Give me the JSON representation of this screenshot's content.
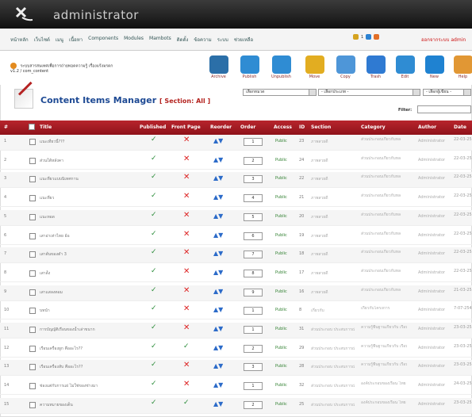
{
  "app": {
    "title": "administrator"
  },
  "menu": {
    "items": [
      "หน้าหลัก",
      "เว็บไซต์",
      "เมนู",
      "เนื้อหา",
      "Components",
      "Modules",
      "Mambots",
      "ติดตั้ง",
      "ข้อความ",
      "ระบบ",
      "ช่วยเหลือ"
    ],
    "count": "1",
    "logout": "ออกจากระบบ admin"
  },
  "breadcrumb": {
    "line1": "ระบบสารสนเทศเพื่อการถ่ายทอดความรู้ เรื่องแร้งมรดก",
    "line2": "v1.2 / com_content"
  },
  "toolbar": [
    {
      "label": "Archive",
      "color": "#2b6fa8"
    },
    {
      "label": "Publish",
      "color": "#2f8cd3"
    },
    {
      "label": "Unpublish",
      "color": "#2f8cd3"
    },
    {
      "label": "Move",
      "color": "#e2ad21"
    },
    {
      "label": "Copy",
      "color": "#4e96d8"
    },
    {
      "label": "Trash",
      "color": "#2f7ad2"
    },
    {
      "label": "Edit",
      "color": "#2f8cd3"
    },
    {
      "label": "New",
      "color": "#1f82d1"
    },
    {
      "label": "Help",
      "color": "#e19734"
    }
  ],
  "manager": {
    "title": "Content Items Manager",
    "section": "[ Section: All ]"
  },
  "filters": {
    "category": "เลือกหมวด",
    "type": "- เลือกประเภท -",
    "author": "- เลือกผู้เขียน -",
    "filter_label": "Filter:"
  },
  "columns": {
    "num": "#",
    "check": "",
    "title": "Title",
    "published": "Published",
    "front": "Front Page",
    "reorder": "Reorder",
    "order": "Order",
    "access": "Access",
    "id": "ID",
    "section": "Section",
    "category": "Category",
    "author": "Author",
    "date": "Date"
  },
  "rows": [
    {
      "num": "1",
      "title": "แนะเที่ยวนี้???",
      "published": "✓",
      "front": "✕",
      "order": "1",
      "access": "Public",
      "id": "23",
      "section": "ภาพสวยดี",
      "category": "ส่วนประกอบเกี่ยวกับหล",
      "author": "Administrator",
      "date": "22-03-2551"
    },
    {
      "num": "2",
      "title": "ส่วนใต้หลังคา",
      "published": "✓",
      "front": "✕",
      "order": "2",
      "access": "Public",
      "id": "24",
      "section": "ภาพสวยดี",
      "category": "ส่วนประกอบเกี่ยวกับหล",
      "author": "Administrator",
      "date": "22-03-2551"
    },
    {
      "num": "3",
      "title": "แนะที่ยวแบบนิเทศกาน",
      "published": "✓",
      "front": "✕",
      "order": "3",
      "access": "Public",
      "id": "22",
      "section": "ภาพสวยดี",
      "category": "ส่วนประกอบเกี่ยวกับหล",
      "author": "Administrator",
      "date": "22-03-2551"
    },
    {
      "num": "4",
      "title": "แนะที่ยว",
      "published": "✓",
      "front": "✕",
      "order": "4",
      "access": "Public",
      "id": "21",
      "section": "ภาพสวยดี",
      "category": "ส่วนประกอบเกี่ยวกับหล",
      "author": "Administrator",
      "date": "22-03-2551"
    },
    {
      "num": "5",
      "title": "แนะทอด",
      "published": "✓",
      "front": "✕",
      "order": "5",
      "access": "Public",
      "id": "20",
      "section": "ภาพสวยดี",
      "category": "ส่วนประกอบเกี่ยวกับหล",
      "author": "Administrator",
      "date": "22-03-2551"
    },
    {
      "num": "6",
      "title": "เสาอ่าเท่าไทย ธ้อ",
      "published": "✓",
      "front": "✕",
      "order": "6",
      "access": "Public",
      "id": "19",
      "section": "ภาพสวยดี",
      "category": "ส่วนประกอบเกี่ยวกับหล",
      "author": "Administrator",
      "date": "22-03-2551"
    },
    {
      "num": "7",
      "title": "เสาต้นของตำ 3",
      "published": "✓",
      "front": "✕",
      "order": "7",
      "access": "Public",
      "id": "18",
      "section": "ภาพสวยดี",
      "category": "ส่วนประกอบเกี่ยวกับหล",
      "author": "Administrator",
      "date": "22-03-2551"
    },
    {
      "num": "8",
      "title": "เสาด้ัง",
      "published": "✓",
      "front": "✕",
      "order": "8",
      "access": "Public",
      "id": "17",
      "section": "ภาพสวยดี",
      "category": "ส่วนประกอบเกี่ยวกับหล",
      "author": "Administrator",
      "date": "22-03-2551"
    },
    {
      "num": "9",
      "title": "เสาแสลงตอม",
      "published": "✓",
      "front": "✕",
      "order": "9",
      "access": "Public",
      "id": "16",
      "section": "ภาพสวยดี",
      "category": "ส่วนประกอบเกี่ยวกับหล",
      "author": "Administrator",
      "date": "21-03-2551"
    },
    {
      "num": "10",
      "title": "บทนำ",
      "published": "✓",
      "front": "✕",
      "order": "1",
      "access": "Public",
      "id": "8",
      "section": "เกี่ยวกับ",
      "category": "เกี่ยวกับโครงการ",
      "author": "Administrator",
      "date": "7-07-2547"
    },
    {
      "num": "11",
      "title": "การบัญญัติเรือนของน้ำเล่าขนาก",
      "published": "✓",
      "front": "✕",
      "order": "1",
      "access": "Public",
      "id": "31",
      "section": "ส่วนประกอบ ประสบการณ์",
      "category": "ความรู้พื้นฐานเกี่ยวกับ เรือนไทย",
      "author": "Administrator",
      "date": "23-03-2551"
    },
    {
      "num": "12",
      "title": "เรือนเครื่องผูก คืออะไร??",
      "published": "✓",
      "front": "✓",
      "order": "2",
      "access": "Public",
      "id": "29",
      "section": "ส่วนประกอบ ประสบการณ์",
      "category": "ความรู้พื้นฐานเกี่ยวกับ เรือนไทย",
      "author": "Administrator",
      "date": "23-03-2551"
    },
    {
      "num": "13",
      "title": "เรือนเครื่องสับ คืออะไร??",
      "published": "✓",
      "front": "✕",
      "order": "3",
      "access": "Public",
      "id": "28",
      "section": "ส่วนประกอบ ประสบการณ์",
      "category": "ความรู้พื้นฐานเกี่ยวกับ เรือนไทย",
      "author": "Administrator",
      "date": "23-03-2551"
    },
    {
      "num": "14",
      "title": "ช่องแต่กับการแผ่ ไม่ใช่ของช่างมา",
      "published": "✓",
      "front": "✕",
      "order": "1",
      "access": "Public",
      "id": "32",
      "section": "ส่วนประกอบ ประสบการณ์",
      "category": "องค์ประกอบของเรือน ไทย",
      "author": "Administrator",
      "date": "24-03-2551"
    },
    {
      "num": "15",
      "title": "ความหมายของเต็น",
      "published": "✓",
      "front": "✓",
      "order": "2",
      "access": "Public",
      "id": "25",
      "section": "ส่วนประกอบ ประสบการณ์",
      "category": "องค์ประกอบของเรือน ไทย",
      "author": "Administrator",
      "date": "23-03-2551"
    }
  ]
}
